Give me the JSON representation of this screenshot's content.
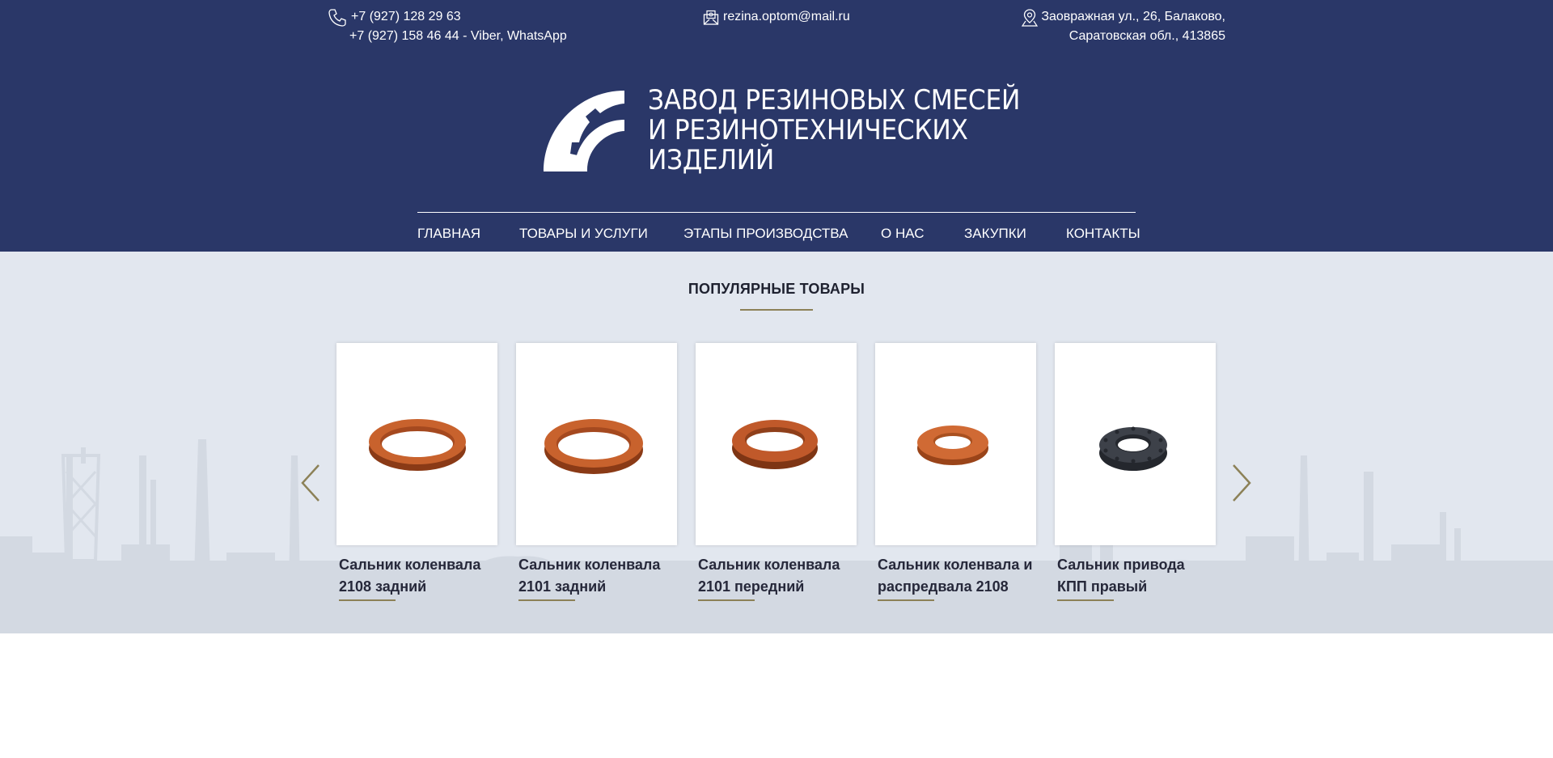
{
  "header": {
    "phone_line1": "+7 (927) 128 29 63",
    "phone_line2": "+7 (927) 158 46 44 - Viber, WhatsApp",
    "email": "rezina.optom@mail.ru",
    "address_line1": "Заовражная ул., 26, Балаково,",
    "address_line2": "Саратовская обл., 413865",
    "brand_line1": "ЗАВОД РЕЗИНОВЫХ СМЕСЕЙ",
    "brand_line2": "И РЕЗИНОТЕХНИЧЕСКИХ",
    "brand_line3": "ИЗДЕЛИЙ",
    "icons": {
      "phone": "phone-icon",
      "email": "email-icon",
      "address": "map-pin-icon",
      "logo": "gear-logo-icon"
    }
  },
  "nav": {
    "items": [
      {
        "label": "ГЛАВНАЯ"
      },
      {
        "label": "ТОВАРЫ И УСЛУГИ"
      },
      {
        "label": "ЭТАПЫ ПРОИЗВОДСТВА"
      },
      {
        "label": "О НАС"
      },
      {
        "label": "ЗАКУПКИ"
      },
      {
        "label": "КОНТАКТЫ"
      }
    ]
  },
  "popular": {
    "title": "ПОПУЛЯРНЫЕ ТОВАРЫ",
    "products": [
      {
        "line1": "Сальник коленвала",
        "line2": "2108 задний",
        "color": "#c8622d"
      },
      {
        "line1": "Сальник коленвала",
        "line2": "2101 задний",
        "color": "#c8622d"
      },
      {
        "line1": "Сальник коленвала",
        "line2": "2101 передний",
        "color": "#c0592a"
      },
      {
        "line1": "Сальник коленвала и",
        "line2": "распредвала 2108",
        "color": "#d06a34"
      },
      {
        "line1": "Сальник привода",
        "line2": "КПП правый",
        "color": "#3d4149"
      }
    ],
    "icons": {
      "prev": "chevron-left-icon",
      "next": "chevron-right-icon"
    }
  },
  "colors": {
    "header_bg": "#2a3768",
    "section_bg": "#e2e7ef",
    "accent": "#8c8157"
  }
}
